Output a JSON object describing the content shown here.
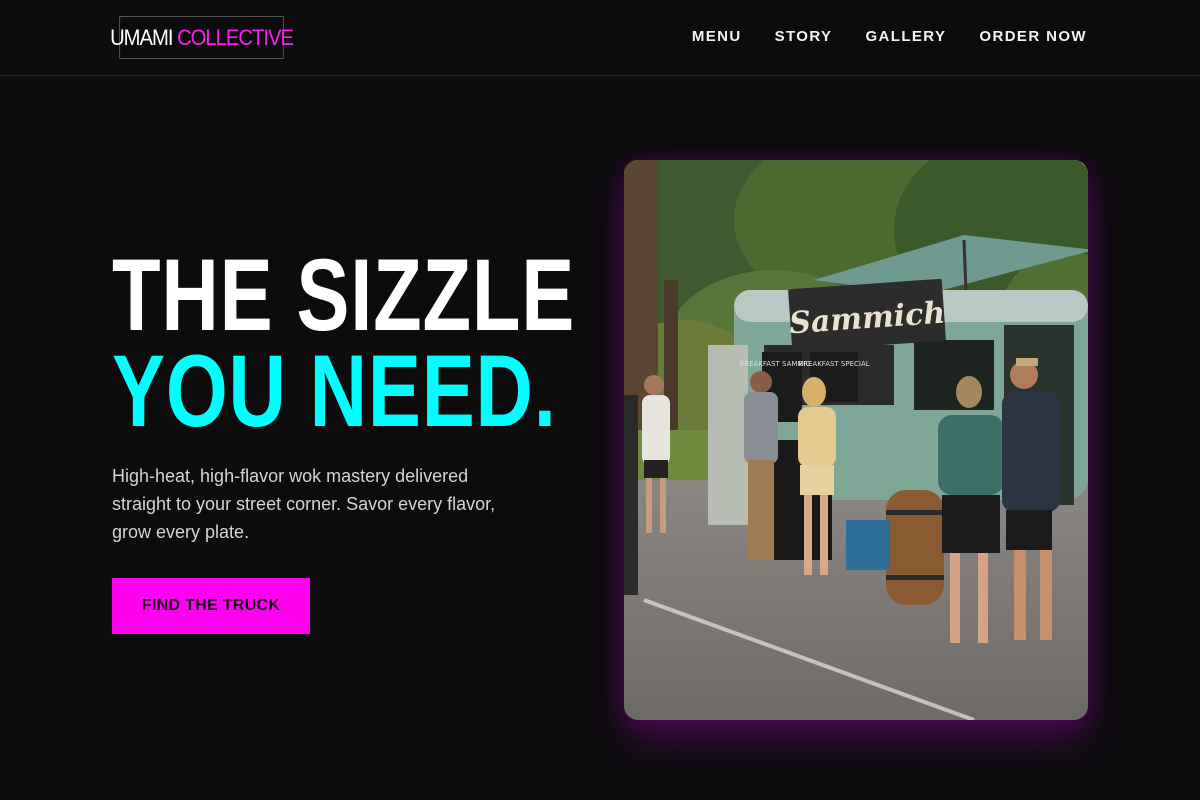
{
  "brand": {
    "word_1": "UMAMI",
    "word_2": "COLLECTIVE",
    "accent_color": "#ff1df0"
  },
  "nav": {
    "items": [
      "MENU",
      "STORY",
      "GALLERY",
      "ORDER NOW"
    ]
  },
  "hero": {
    "headline_line_1": "THE SIZZLE",
    "headline_line_2": "YOU NEED.",
    "headline_accent_color": "#00ffff",
    "subtext": "High-heat, high-flavor wok mastery delivered straight to your street corner. Savor every flavor, grow every plate.",
    "cta_label": "FIND THE TRUCK",
    "cta_color": "#ff00f0"
  },
  "photo": {
    "truck_sign": "Sammich",
    "board_1": "BREAKFAST SAMMICHES",
    "board_2": "BREAKFAST SPECIAL"
  },
  "colors": {
    "background": "#0c0c0d"
  }
}
